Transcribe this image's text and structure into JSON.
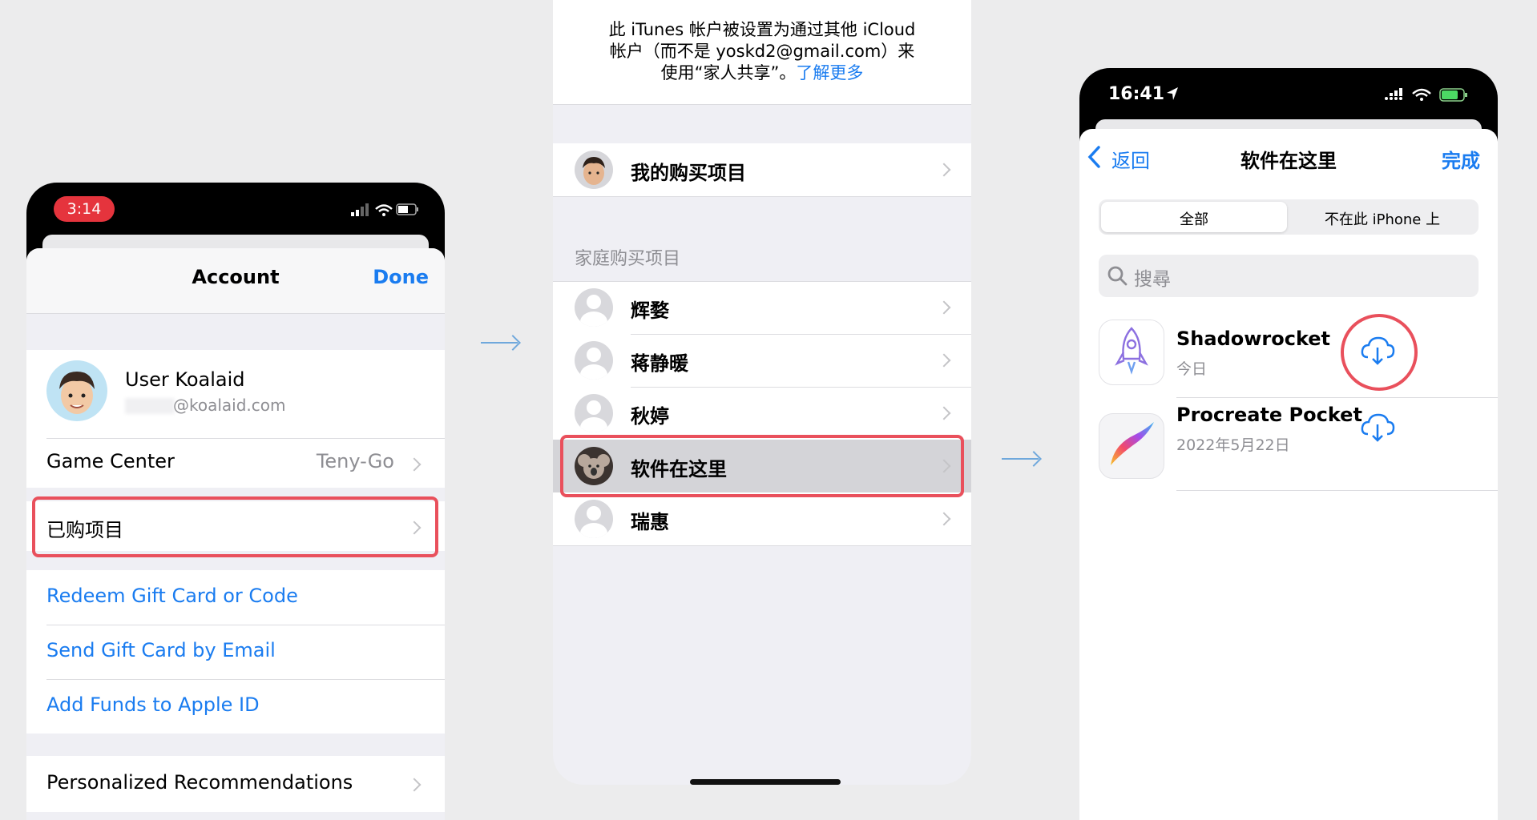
{
  "phone1": {
    "status_time": "3:14",
    "title": "Account",
    "done": "Done",
    "user_name": "User Koalaid",
    "user_email": "@koalaid.com",
    "game_center_label": "Game Center",
    "game_center_value": "Teny-Go",
    "purchased": "已购项目",
    "links": [
      "Redeem Gift Card or Code",
      "Send Gift Card by Email",
      "Add Funds to Apple ID"
    ],
    "personalized": "Personalized Recommendations"
  },
  "phone2": {
    "notice_line1": "此 iTunes 帐户被设置为通过其他 iCloud",
    "notice_line2": "帐户（而不是 yoskd2@gmail.com）来",
    "notice_line3": "使用“家人共享”。",
    "learn_more": "了解更多",
    "my_purchases": "我的购买项目",
    "family_header": "家庭购买项目",
    "members": [
      "辉婺",
      "蒋静暖",
      "秋婷",
      "软件在这里",
      "瑞惠"
    ]
  },
  "phone3": {
    "status_time": "16:41",
    "back": "返回",
    "title": "软件在这里",
    "done": "完成",
    "segments": [
      "全部",
      "不在此 iPhone 上"
    ],
    "search_placeholder": "搜尋",
    "apps": [
      {
        "name": "Shadowrocket",
        "date": "今日"
      },
      {
        "name": "Procreate Pocket",
        "date": "2022年5月22日"
      }
    ]
  },
  "colors": {
    "accent": "#1a7cf0",
    "highlight": "#e9505c",
    "recording": "#e5343d"
  }
}
